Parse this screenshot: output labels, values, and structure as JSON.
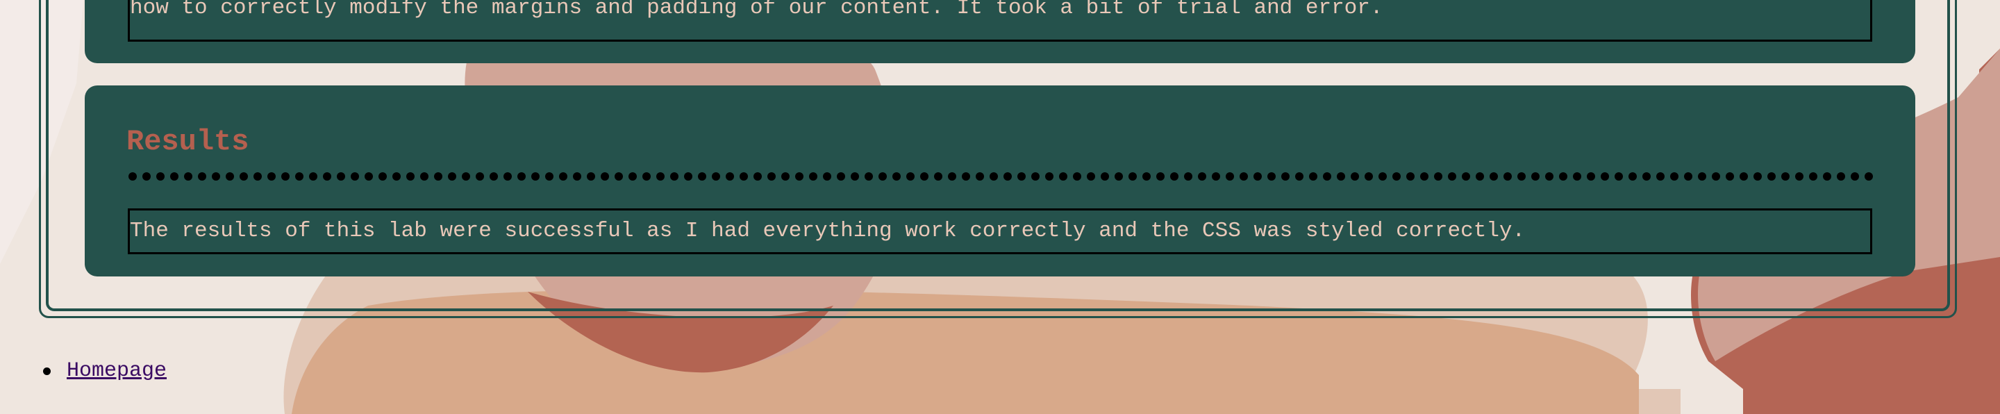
{
  "colors": {
    "page_background": "#efe6df",
    "card": "#25524c",
    "frame": "#22524b",
    "heading": "#b5604f",
    "body_text": "#e9c8b8",
    "link": "#3a0b63"
  },
  "previous_section": {
    "text": "how to correctly modify the margins and padding of our content. It took a bit of trial and error."
  },
  "results": {
    "heading": "Results",
    "text": "The results of this lab were successful as I had everything work correctly and the CSS was styled correctly."
  },
  "nav": {
    "items": [
      {
        "label": "Homepage"
      }
    ]
  }
}
